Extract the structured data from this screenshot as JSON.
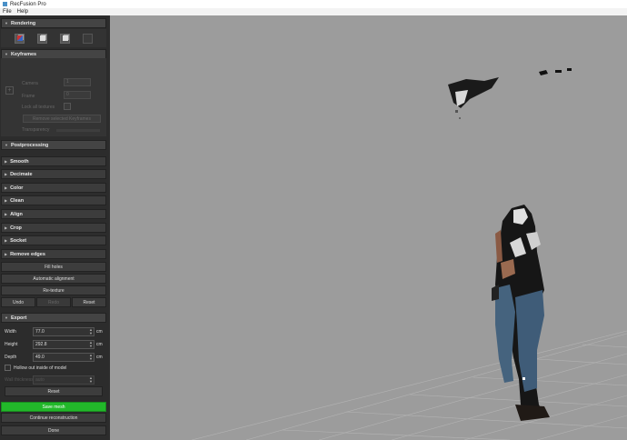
{
  "app": {
    "title": "RecFusion Pro"
  },
  "menu": [
    "File",
    "Help"
  ],
  "sections": {
    "rendering": "Rendering",
    "keyframes": "Keyframes",
    "postprocessing": "Postprocessing",
    "smooth": "Smooth",
    "decimate": "Decimate",
    "color": "Color",
    "clean": "Clean",
    "align": "Align",
    "crop": "Crop",
    "socket": "Socket",
    "remove_edges": "Remove edges",
    "export": "Export"
  },
  "keyframes": {
    "camera_label": "Camera",
    "camera_value": "1",
    "frame_label": "Frame",
    "frame_value": "0",
    "lock_label": "Lock all textures",
    "remove_button": "Remove selected Keyframes",
    "transparency_label": "Transparency"
  },
  "actions": {
    "fill_holes": "Fill holes",
    "auto_align": "Automatic alignment",
    "retexture": "Re-texture",
    "undo": "Undo",
    "redo": "Redo",
    "reset": "Reset"
  },
  "export": {
    "width_label": "Width",
    "width_value": "77.0",
    "height_label": "Height",
    "height_value": "292.8",
    "depth_label": "Depth",
    "depth_value": "49.0",
    "unit": "cm",
    "hollow_label": "Hollow out inside of model",
    "wall_label": "Wall thickness",
    "wall_value": "auto",
    "reset": "Reset"
  },
  "footer": {
    "save": "Save mesh",
    "continue": "Continue reconstruction",
    "done": "Done"
  },
  "colors": {
    "save_green": "#22b82a",
    "sidebar_bg": "#2c2c2c",
    "viewport_bg": "#9c9c9c"
  }
}
